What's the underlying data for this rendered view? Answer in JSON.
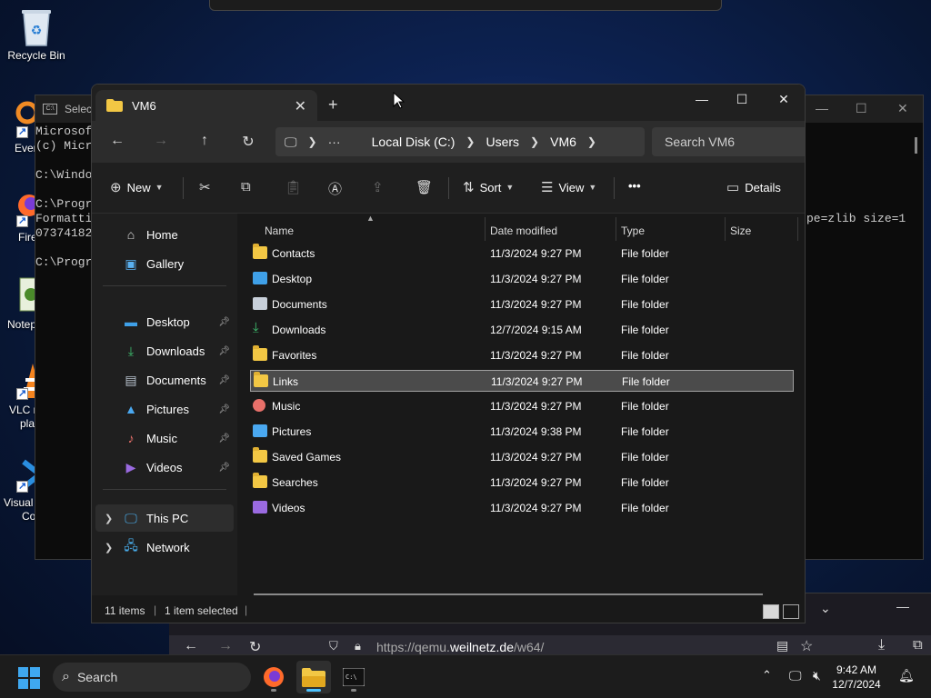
{
  "desktop": {
    "icons": [
      {
        "label": "Recycle Bin",
        "icon": "recycle-bin-icon"
      },
      {
        "label": "Every",
        "icon": "everything-icon"
      },
      {
        "label": "Fire",
        "icon": "firefox-icon"
      },
      {
        "label": "Notep",
        "icon": "notepad-icon"
      },
      {
        "label": "VLC r",
        "label2": "pla",
        "icon": "vlc-icon"
      },
      {
        "label": "Visual",
        "label2": "Co",
        "icon": "vscode-icon"
      }
    ]
  },
  "console": {
    "title": "Selec",
    "lines": [
      "Microsof",
      "(c) Micr",
      "",
      "C:\\Windo",
      "",
      "C:\\Progr",
      "Formatti",
      "07374182",
      "",
      "C:\\Progr"
    ],
    "right_text": "pe=zlib size=1"
  },
  "browser": {
    "url_prefix": "https://qemu.",
    "url_domain": "weilnetz.de",
    "url_suffix": "/w64/"
  },
  "explorer": {
    "tab_title": "VM6",
    "new_tab_symbol": "+",
    "breadcrumb": [
      "Local Disk (C:)",
      "Users",
      "VM6"
    ],
    "search_placeholder": "Search VM6",
    "commands": {
      "new": "New",
      "sort": "Sort",
      "view": "View",
      "more": "•••",
      "details": "Details"
    },
    "sidebar": {
      "top": [
        {
          "label": "Home",
          "icon": "home-icon"
        },
        {
          "label": "Gallery",
          "icon": "gallery-icon"
        }
      ],
      "quick": [
        {
          "label": "Desktop",
          "icon": "desktop-folder-icon"
        },
        {
          "label": "Downloads",
          "icon": "downloads-icon"
        },
        {
          "label": "Documents",
          "icon": "documents-icon"
        },
        {
          "label": "Pictures",
          "icon": "pictures-icon"
        },
        {
          "label": "Music",
          "icon": "music-icon"
        },
        {
          "label": "Videos",
          "icon": "videos-icon"
        }
      ],
      "tree": [
        {
          "label": "This PC",
          "icon": "this-pc-icon"
        },
        {
          "label": "Network",
          "icon": "network-icon"
        }
      ]
    },
    "columns": {
      "name": "Name",
      "date": "Date modified",
      "type": "Type",
      "size": "Size"
    },
    "rows": [
      {
        "name": "Contacts",
        "date": "11/3/2024 9:27 PM",
        "type": "File folder",
        "icon": "folder-icon"
      },
      {
        "name": "Desktop",
        "date": "11/3/2024 9:27 PM",
        "type": "File folder",
        "icon": "desktop-folder-icon"
      },
      {
        "name": "Documents",
        "date": "11/3/2024 9:27 PM",
        "type": "File folder",
        "icon": "documents-icon"
      },
      {
        "name": "Downloads",
        "date": "12/7/2024 9:15 AM",
        "type": "File folder",
        "icon": "downloads-icon"
      },
      {
        "name": "Favorites",
        "date": "11/3/2024 9:27 PM",
        "type": "File folder",
        "icon": "folder-icon"
      },
      {
        "name": "Links",
        "date": "11/3/2024 9:27 PM",
        "type": "File folder",
        "icon": "folder-icon"
      },
      {
        "name": "Music",
        "date": "11/3/2024 9:27 PM",
        "type": "File folder",
        "icon": "music-icon"
      },
      {
        "name": "Pictures",
        "date": "11/3/2024 9:38 PM",
        "type": "File folder",
        "icon": "pictures-icon"
      },
      {
        "name": "Saved Games",
        "date": "11/3/2024 9:27 PM",
        "type": "File folder",
        "icon": "folder-icon"
      },
      {
        "name": "Searches",
        "date": "11/3/2024 9:27 PM",
        "type": "File folder",
        "icon": "folder-icon"
      },
      {
        "name": "Videos",
        "date": "11/3/2024 9:27 PM",
        "type": "File folder",
        "icon": "videos-icon"
      }
    ],
    "selected_row": "Links",
    "status": {
      "items": "11 items",
      "selected": "1 item selected"
    }
  },
  "taskbar": {
    "search_label": "Search",
    "apps": [
      "firefox-icon",
      "file-explorer-icon",
      "terminal-icon"
    ],
    "active_app": "file-explorer-icon",
    "time": "9:42 AM",
    "date": "12/7/2024"
  },
  "colors": {
    "accent": "#4cc2ff",
    "folder": "#f2c744",
    "selection": "#4b4b4b"
  }
}
